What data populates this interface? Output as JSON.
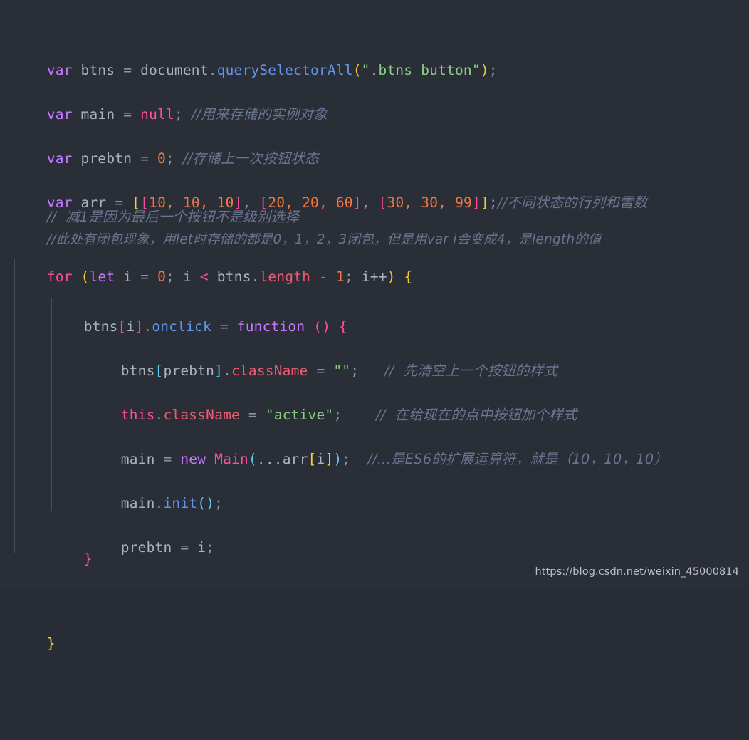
{
  "editor": {
    "language": "javascript",
    "theme": "dark",
    "background_color": "#2a2e37",
    "indent_guide_color": "#4b5263"
  },
  "colors": {
    "keyword_var": "#c678ff",
    "keyword_control": "#ff4d9e",
    "identifier": "#abb2bf",
    "property": "#6196ec",
    "member": "#ef596f",
    "string": "#89d185",
    "number": "#f07847",
    "punctuation": "#8d93a1",
    "bracket_depth1": "#f5d033",
    "bracket_depth2": "#ff4d9e",
    "bracket_depth3": "#5bc8f5",
    "comment": "#6b7490"
  },
  "code": {
    "line1": {
      "kw": "var",
      "name": "btns",
      "eq": "=",
      "obj": "document",
      "dot": ".",
      "method": "querySelectorAll",
      "paren_open": "(",
      "string": "\".btns button\"",
      "paren_close": ")",
      "semi": ";"
    },
    "line2": {
      "kw": "var",
      "name": "main",
      "eq": "=",
      "value": "null",
      "semi": ";",
      "comment": "//用来存储的实例对象"
    },
    "line3": {
      "kw": "var",
      "name": "prebtn",
      "eq": "=",
      "value": "0",
      "semi": ";",
      "comment": "//存储上一次按钮状态"
    },
    "line4": {
      "kw": "var",
      "name": "arr",
      "eq": "=",
      "outer_open": "[",
      "a1_open": "[",
      "a1": "10, 10, 10",
      "a1_close": "]",
      "sep1": ", ",
      "a2_open": "[",
      "a2": "20, 20, 60",
      "a2_close": "]",
      "sep2": ", ",
      "a3_open": "[",
      "a3": "30, 30, 99",
      "a3_close": "]",
      "outer_close": "]",
      "semi": ";",
      "comment": "//不同状态的行列和雷数"
    },
    "line5": {
      "comment": "//  减1是因为最后一个按钮不是级别选择"
    },
    "line6": {
      "comment": "//此处有闭包现象，用let时存储的都是0，1，2，3闭包，但是用var i会变成4，是length的值"
    },
    "line7": {
      "kw_for": "for",
      "paren_open": "(",
      "kw_let": "let",
      "var_i": "i",
      "eq": "=",
      "init": "0",
      "semi1": ";",
      "cond_i": "i",
      "lt": "<",
      "obj": "btns",
      "dot": ".",
      "len": "length",
      "minus": "-",
      "one": "1",
      "semi2": ";",
      "inc": "i++",
      "paren_close": ")",
      "brace_open": "{"
    },
    "line8": {
      "obj": "btns",
      "br_open": "[",
      "idx": "i",
      "br_close": "]",
      "dot": ".",
      "prop": "onclick",
      "eq": "=",
      "kw_function": "function",
      "parens": "()",
      "brace_open": "{"
    },
    "line9": {
      "obj": "btns",
      "br_open": "[",
      "idx": "prebtn",
      "br_close": "]",
      "dot": ".",
      "member": "className",
      "eq": "=",
      "string": "\"\"",
      "semi": ";",
      "comment": "//  先清空上一个按钮的样式"
    },
    "line10": {
      "kw_this": "this",
      "dot": ".",
      "member": "className",
      "eq": "=",
      "string": "\"active\"",
      "semi": ";",
      "comment": "//  在给现在的点中按钮加个样式"
    },
    "line11": {
      "name": "main",
      "eq": "=",
      "kw_new": "new",
      "cls": "Main",
      "paren_open": "(",
      "spread": "...arr",
      "br_open": "[",
      "idx": "i",
      "br_close": "]",
      "paren_close": ")",
      "semi": ";",
      "comment": "//...是ES6的扩展运算符，就是（10，10，10）"
    },
    "line12": {
      "obj": "main",
      "dot": ".",
      "method": "init",
      "parens": "()",
      "semi": ";"
    },
    "line13": {
      "name": "prebtn",
      "eq": "=",
      "value": "i",
      "semi": ";"
    },
    "line14": {
      "brace_close": "}"
    },
    "line15": {
      "brace_close": "}"
    }
  },
  "watermark": {
    "text": "https://blog.csdn.net/weixin_45000814"
  }
}
